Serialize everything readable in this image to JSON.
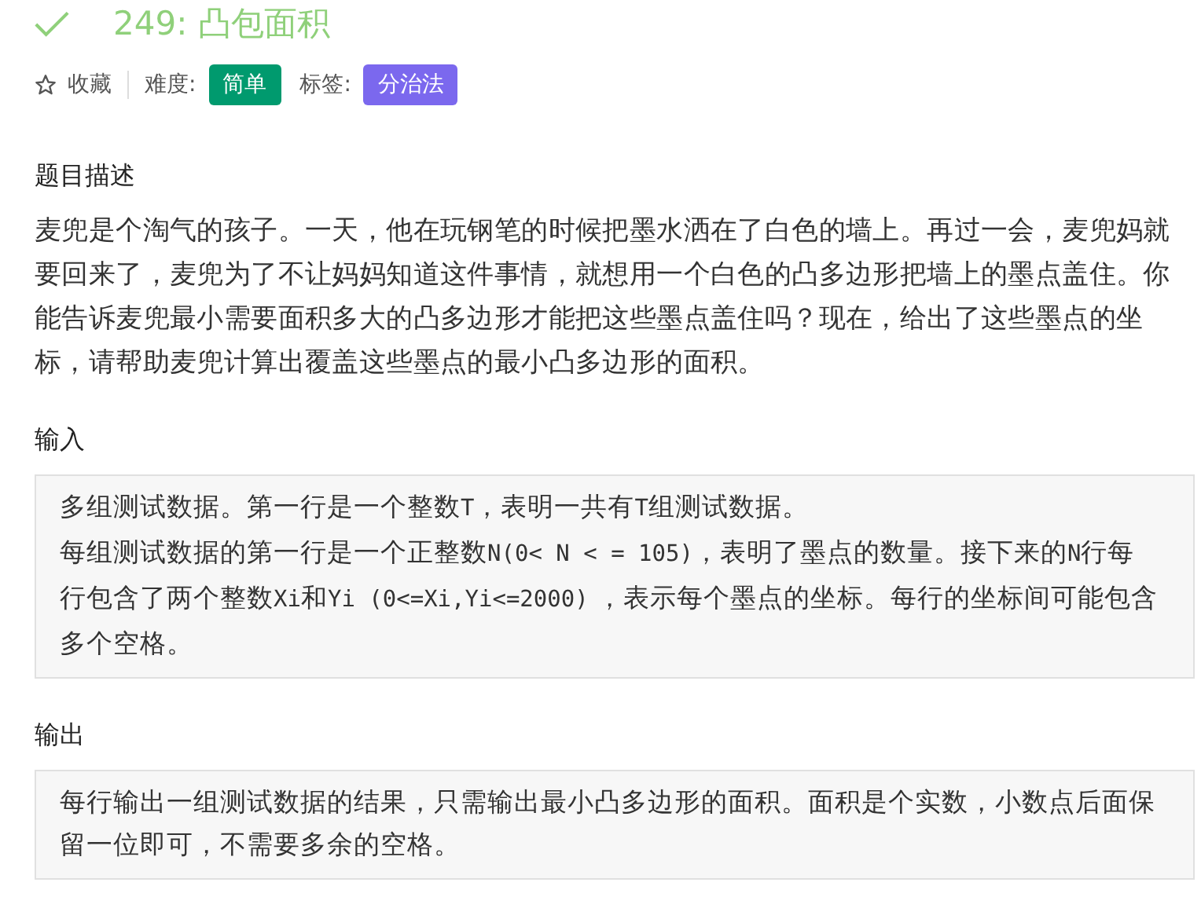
{
  "problem": {
    "solved": true,
    "title": "249: 凸包面积"
  },
  "meta": {
    "favorite": {
      "label": "收藏",
      "starred": false
    },
    "difficulty_label": "难度:",
    "difficulty": "简单",
    "tags_label": "标签:",
    "tags": [
      "分治法"
    ]
  },
  "sections": [
    {
      "heading": "题目描述",
      "boxed": false,
      "paragraphs": [
        [
          {
            "kind": "text",
            "text": "麦兜是个淘气的孩子。一天，他在玩钢笔的时候把墨水洒在了白色的墙上。再过一会，麦兜妈就要回来了，麦兜为了不让妈妈知道这件事情，就想用一个白色的凸多边形把墙上的墨点盖住。你能告诉麦兜最小需要面积多大的凸多边形才能把这些墨点盖住吗？现在，给出了这些墨点的坐标，请帮助麦兜计算出覆盖这些墨点的最小凸多边形的面积。"
          }
        ]
      ]
    },
    {
      "heading": "输入",
      "boxed": true,
      "paragraphs": [
        [
          {
            "kind": "text",
            "text": "多组测试数据。第一行是一个整数"
          },
          {
            "kind": "code",
            "text": "T"
          },
          {
            "kind": "text",
            "text": "，表明一共有"
          },
          {
            "kind": "code",
            "text": "T"
          },
          {
            "kind": "text",
            "text": "组测试数据。"
          }
        ],
        [
          {
            "kind": "text",
            "text": "每组测试数据的第一行是一个正整数"
          },
          {
            "kind": "code",
            "text": "N(0< N < = 105)"
          },
          {
            "kind": "text",
            "text": "，表明了墨点的数量。接下来的"
          },
          {
            "kind": "code",
            "text": "N"
          },
          {
            "kind": "text",
            "text": "行每行包含了两个整数"
          },
          {
            "kind": "code",
            "text": "Xi"
          },
          {
            "kind": "text",
            "text": "和"
          },
          {
            "kind": "code",
            "text": "Yi (0<=Xi,Yi<=2000)"
          },
          {
            "kind": "text",
            "text": " ，表示每个墨点的坐标。每行的坐标间可能包含多个空格。"
          }
        ]
      ]
    },
    {
      "heading": "输出",
      "boxed": true,
      "paragraphs": [
        [
          {
            "kind": "text",
            "text": "每行输出一组测试数据的结果，只需输出最小凸多边形的面积。面积是个实数，小数点后面保留一位即可，不需要多余的空格。"
          }
        ]
      ]
    }
  ]
}
